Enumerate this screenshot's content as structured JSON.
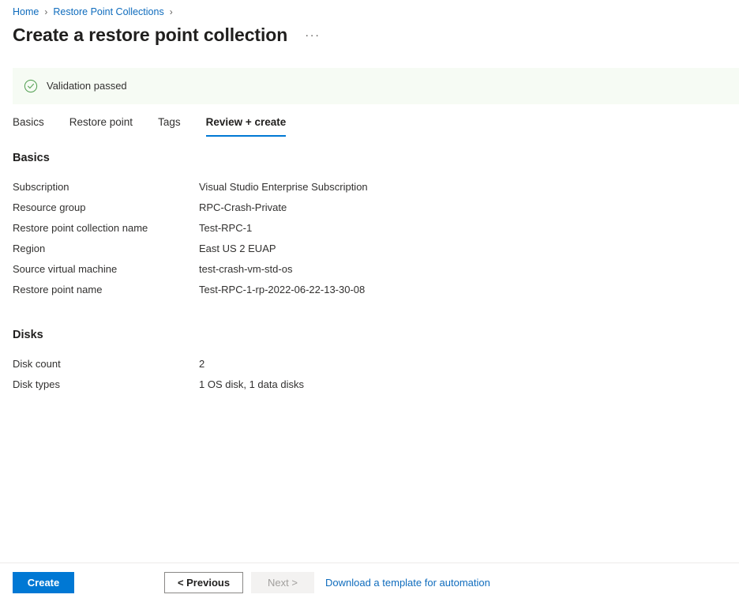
{
  "breadcrumb": {
    "items": [
      {
        "label": "Home"
      },
      {
        "label": "Restore Point Collections"
      }
    ],
    "separator": "›",
    "trailing_separator": "›"
  },
  "header": {
    "title": "Create a restore point collection",
    "more_menu": "···"
  },
  "validation": {
    "message": "Validation passed",
    "icon": "check-circle-icon",
    "background": "#f6fbf4",
    "icon_color": "#5ba45b"
  },
  "tabs": [
    {
      "label": "Basics",
      "active": false
    },
    {
      "label": "Restore point",
      "active": false
    },
    {
      "label": "Tags",
      "active": false
    },
    {
      "label": "Review + create",
      "active": true
    }
  ],
  "sections": [
    {
      "heading": "Basics",
      "rows": [
        {
          "label": "Subscription",
          "value": "Visual Studio Enterprise Subscription"
        },
        {
          "label": "Resource group",
          "value": "RPC-Crash-Private"
        },
        {
          "label": "Restore point collection name",
          "value": "Test-RPC-1"
        },
        {
          "label": "Region",
          "value": "East US 2 EUAP"
        },
        {
          "label": "Source virtual machine",
          "value": "test-crash-vm-std-os"
        },
        {
          "label": "Restore point name",
          "value": "Test-RPC-1-rp-2022-06-22-13-30-08"
        }
      ]
    },
    {
      "heading": "Disks",
      "rows": [
        {
          "label": "Disk count",
          "value": "2"
        },
        {
          "label": "Disk types",
          "value": "1 OS disk, 1 data disks"
        }
      ]
    }
  ],
  "footer": {
    "create_label": "Create",
    "previous_label": "< Previous",
    "next_label": "Next >",
    "download_link_label": "Download a template for automation"
  },
  "colors": {
    "accent": "#0078d4",
    "link": "#0f6cbd",
    "text": "#323130",
    "success": "#5ba45b"
  }
}
